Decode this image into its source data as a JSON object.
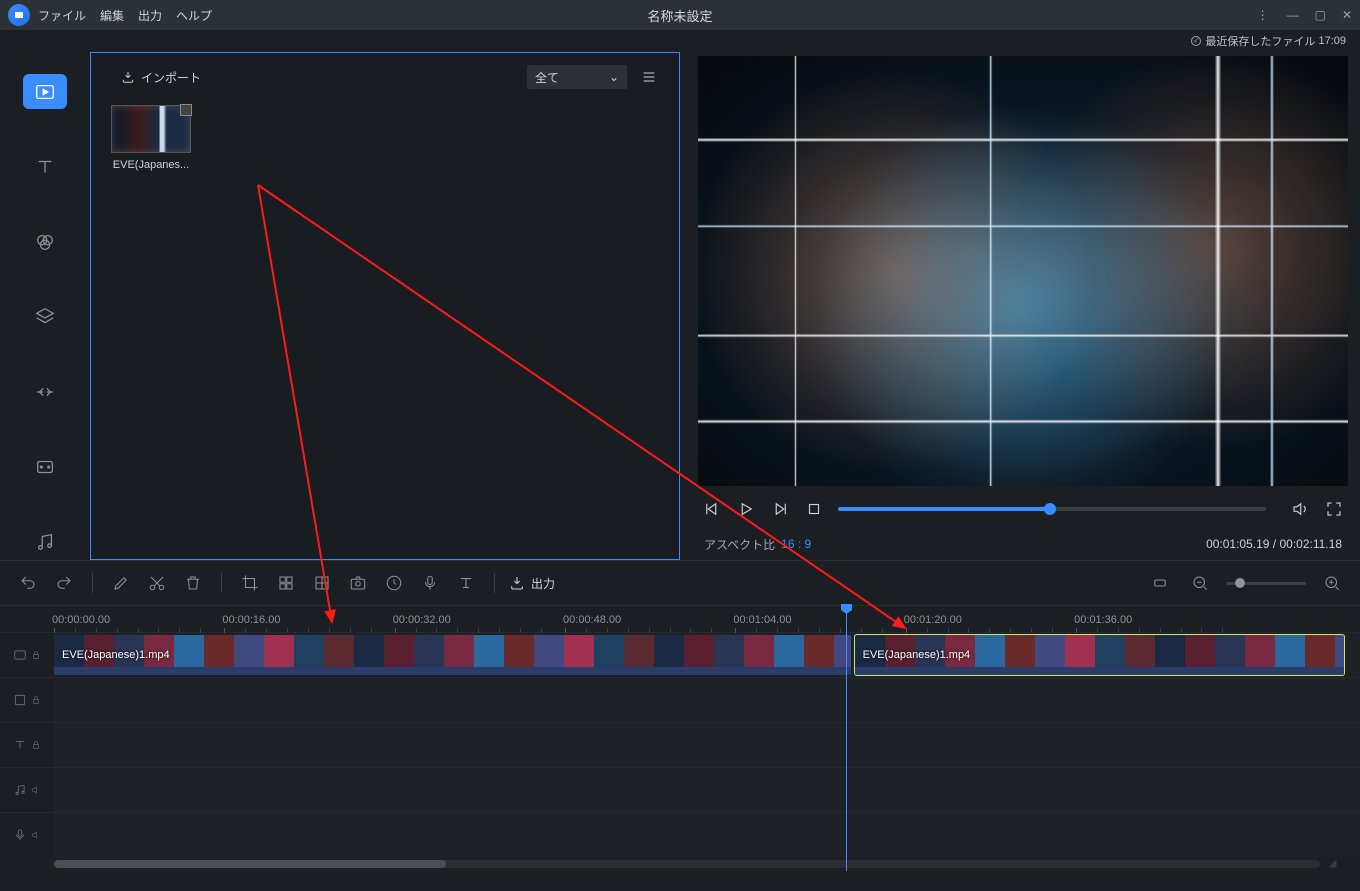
{
  "title": "名称未設定",
  "menu": {
    "file": "ファイル",
    "edit": "編集",
    "output": "出力",
    "help": "ヘルプ"
  },
  "status": {
    "saved_label": "最近保存したファイル",
    "saved_time": "17:09"
  },
  "media": {
    "import_label": "インポート",
    "filter_label": "全て",
    "items": [
      {
        "name": "EVE(Japanes..."
      }
    ]
  },
  "preview": {
    "aspect_label": "アスペクト比",
    "aspect_value": "16 : 9",
    "time_current": "00:01:05.19",
    "time_total": "00:02:11.18",
    "progress_pct": 49.6
  },
  "toolbar": {
    "export_label": "出力",
    "zoom_pct": 18
  },
  "timeline": {
    "time_labels": [
      "00:00:00.00",
      "00:00:16.00",
      "00:00:32.00",
      "00:00:48.00",
      "00:01:04.00",
      "00:01:20.00",
      "00:01:36.00"
    ],
    "playhead_pct": 61.3,
    "clips": [
      {
        "name": "EVE(Japanese)1.mp4",
        "start_pct": 0,
        "width_pct": 61.0,
        "selected": false
      },
      {
        "name": "EVE(Japanese)1.mp4",
        "start_pct": 61.3,
        "width_pct": 37.5,
        "selected": true
      }
    ],
    "scroll_thumb": {
      "left_pct": 0,
      "width_pct": 31
    }
  }
}
